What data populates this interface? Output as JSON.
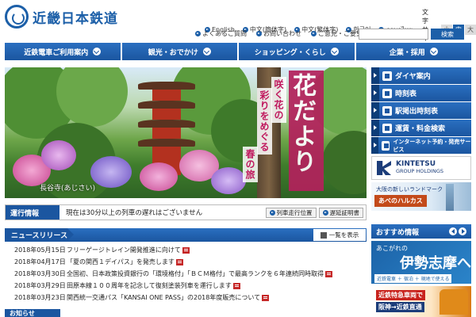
{
  "header": {
    "logo_text": "近畿日本鉄道",
    "languages": [
      "English",
      "中文(簡体字)",
      "中文(繁体字)",
      "한국어",
      "ภาษาไทย"
    ],
    "font_size_label": "文字サイズ",
    "font_sizes": [
      "小",
      "中",
      "大"
    ],
    "font_size_selected": "中",
    "util_links": [
      "よくあるご質問",
      "お問い合わせ",
      "ご意見・ご要望"
    ],
    "search": {
      "placeholder": "",
      "button_label": "検索"
    }
  },
  "global_nav": [
    "近鉄電車ご利用案内",
    "観光・おでかけ",
    "ショッピング・くらし",
    "企業・採用"
  ],
  "hero": {
    "title": "花だより",
    "sub1": "咲く花の",
    "sub2": "彩りをめぐる",
    "sub3": "春の旅",
    "caption": "長谷寺(あじさい)"
  },
  "sidebar": {
    "items": [
      "ダイヤ案内",
      "時刻表",
      "駅掲出時刻表",
      "運賃・料金検索",
      "インターネット予約・発売サービス"
    ],
    "group": {
      "title": "KINTETSU",
      "subtitle": "GROUP HOLDINGS"
    },
    "abeno": {
      "top": "大阪の新しいランドマーク",
      "badge": "あべのハルカス"
    }
  },
  "notice": {
    "label": "運行情報",
    "text": "現在は30分以上の列車の遅れはございません",
    "btn1": "列車走行位置",
    "btn2": "遅延証明書"
  },
  "news": {
    "title": "ニュースリリース",
    "more": "一覧を表示",
    "items": [
      {
        "date": "2018年05月15日",
        "text": "フリーゲージトレイン開発推進に向けて"
      },
      {
        "date": "2018年04月17日",
        "text": "「夏の関西１デイパス」を発売します"
      },
      {
        "date": "2018年03月30日",
        "text": "全国初、日本政策投資銀行の「環境格付」「ＢＣＭ格付」で最高ランクを６年連続同時取得"
      },
      {
        "date": "2018年03月29日",
        "text": "田原本線１００周年を記念して復刻塗装列車を運行します"
      },
      {
        "date": "2018年03月23日",
        "text": "関西統一交通パス「KANSAI ONE PASS」の2018年度販売について"
      }
    ]
  },
  "bottom_tab": "お知らせ",
  "recommend": {
    "title": "おすすめ情報",
    "banner1_top": "あこがれの",
    "banner1_main": "伊勢志摩へ",
    "banner1_badge": "近鉄電車 ＋ 宿泊 ＋ 現地で使える",
    "banner2_line1": "近鉄特急車両で",
    "banner2_line2": "阪神→近鉄直通"
  }
}
